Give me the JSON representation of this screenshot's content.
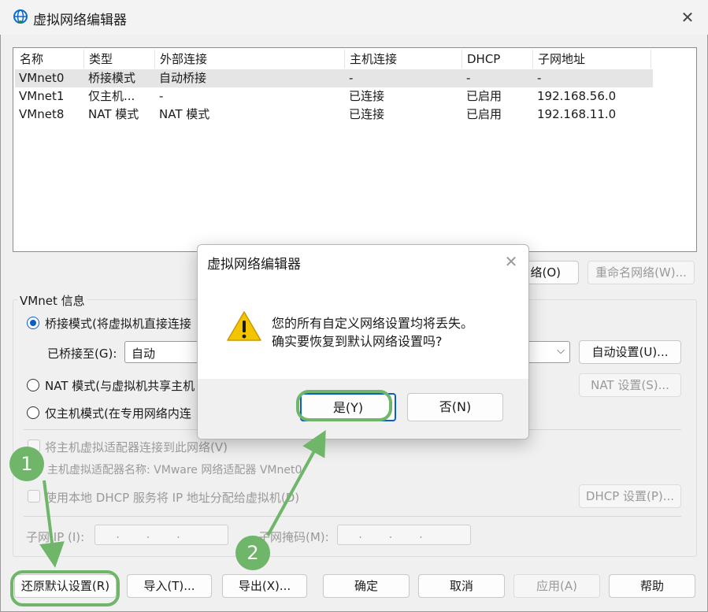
{
  "window": {
    "title": "虚拟网络编辑器",
    "close_glyph": "✕"
  },
  "table": {
    "headers": [
      "名称",
      "类型",
      "外部连接",
      "主机连接",
      "DHCP",
      "子网地址"
    ],
    "rows": [
      [
        "VMnet0",
        "桥接模式",
        "自动桥接",
        "-",
        "-",
        "-"
      ],
      [
        "VMnet1",
        "仅主机...",
        "-",
        "已连接",
        "已启用",
        "192.168.56.0"
      ],
      [
        "VMnet8",
        "NAT 模式",
        "NAT 模式",
        "已连接",
        "已启用",
        "192.168.11.0"
      ]
    ]
  },
  "network_buttons": {
    "remove_partial": "络(O)",
    "rename": "重命名网络(W)..."
  },
  "vmnet_info": {
    "group_title": "VMnet 信息",
    "bridged_label": "桥接模式(将虚拟机直接连接",
    "bridged_to_label": "已桥接至(G):",
    "bridged_to_value": "自动",
    "auto_settings": "自动设置(U)...",
    "nat_label": "NAT 模式(与虚拟机共享主机",
    "nat_settings": "NAT 设置(S)...",
    "hostonly_label": "仅主机模式(在专用网络内连",
    "connect_adapter": "将主机虚拟适配器连接到此网络(V)",
    "adapter_name": "主机虚拟适配器名称: VMware 网络适配器 VMnet0",
    "use_dhcp": "使用本地 DHCP 服务将 IP 地址分配给虚拟机(D)",
    "dhcp_settings": "DHCP 设置(P)...",
    "subnet_ip_label": "子网 IP (I):",
    "subnet_mask_label": "子网掩码(M):",
    "ip_placeholder": "...",
    "mask_placeholder": "..."
  },
  "bottom_buttons": {
    "restore": "还原默认设置(R)",
    "import": "导入(T)...",
    "export": "导出(X)...",
    "ok": "确定",
    "cancel": "取消",
    "apply": "应用(A)",
    "help": "帮助"
  },
  "dialog": {
    "title": "虚拟网络编辑器",
    "close_glyph": "✕",
    "line1": "您的所有自定义网络设置均将丢失。",
    "line2": "确实要恢复到默认网络设置吗?",
    "yes": "是(Y)",
    "no": "否(N)"
  },
  "annotations": {
    "step1": "1",
    "step2": "2",
    "highlight_color": "#6fb56a"
  }
}
